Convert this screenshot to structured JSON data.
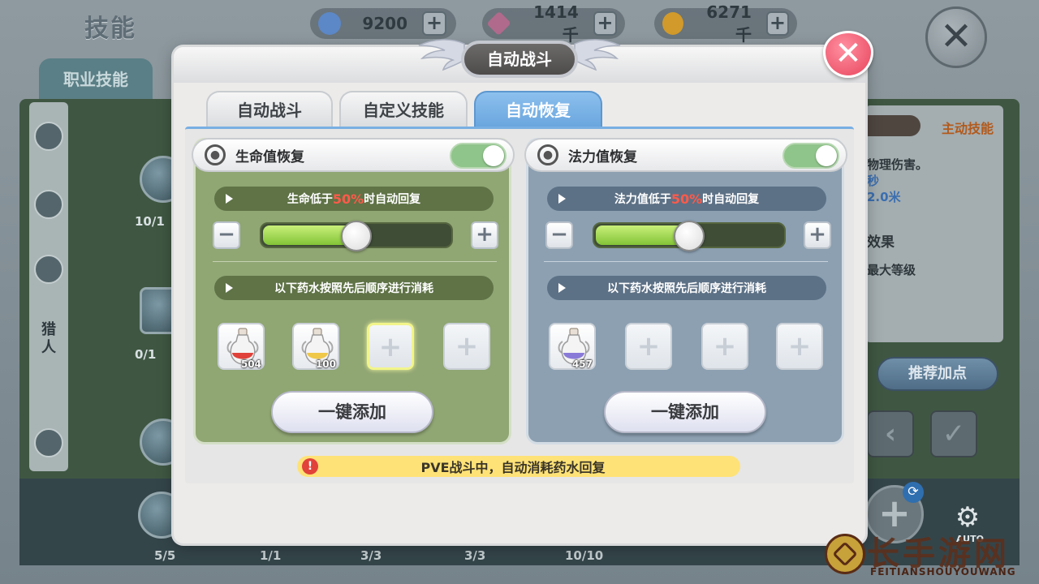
{
  "background": {
    "title": "技能",
    "currencies": [
      {
        "value": "9200",
        "color": "#5c88c7"
      },
      {
        "value": "1414千",
        "color": "#b06a8c"
      },
      {
        "value": "6271千",
        "color": "#d19a2a"
      }
    ],
    "tab_label": "职业技能",
    "sidebar_label": "猎\n人",
    "right_panel": {
      "title": "主动技能",
      "lines": [
        "物理伤害。",
        "秒",
        "2.0米",
        "效果",
        "最大等级"
      ],
      "recommend_button": "推荐加点"
    },
    "levels_left": [
      "10/1",
      "0/1"
    ],
    "bottom_counts": [
      "5/5",
      "1/1",
      "3/3",
      "3/3",
      "10/10"
    ],
    "auto_label": "AUTO"
  },
  "modal": {
    "title": "自动战斗",
    "tabs": [
      {
        "label": "自动战斗",
        "active": false
      },
      {
        "label": "自定义技能",
        "active": false
      },
      {
        "label": "自动恢复",
        "active": true
      }
    ],
    "hp_panel": {
      "title": "生命值恢复",
      "toggle_on": true,
      "threshold_prefix": "生命低于",
      "threshold_value": "50%",
      "threshold_suffix": "时自动回复",
      "slider_fraction": 0.5,
      "order_text": "以下药水按照先后顺序进行消耗",
      "slots": [
        {
          "potion": "red",
          "count": "504"
        },
        {
          "potion": "yellow",
          "count": "100"
        },
        {
          "potion": null,
          "highlight": true
        },
        {
          "potion": null
        }
      ],
      "add_button": "一键添加"
    },
    "mp_panel": {
      "title": "法力值恢复",
      "toggle_on": true,
      "threshold_prefix": "法力值低于",
      "threshold_value": "50%",
      "threshold_suffix": "时自动回复",
      "slider_fraction": 0.5,
      "order_text": "以下药水按照先后顺序进行消耗",
      "slots": [
        {
          "potion": "blue",
          "count": "457"
        },
        {
          "potion": null
        },
        {
          "potion": null
        },
        {
          "potion": null
        }
      ],
      "add_button": "一键添加"
    },
    "notice": "PVE战斗中，自动消耗药水回复"
  },
  "watermark": {
    "text": "长手游网",
    "sub": "FEITIANSHOUYOUWANG"
  }
}
